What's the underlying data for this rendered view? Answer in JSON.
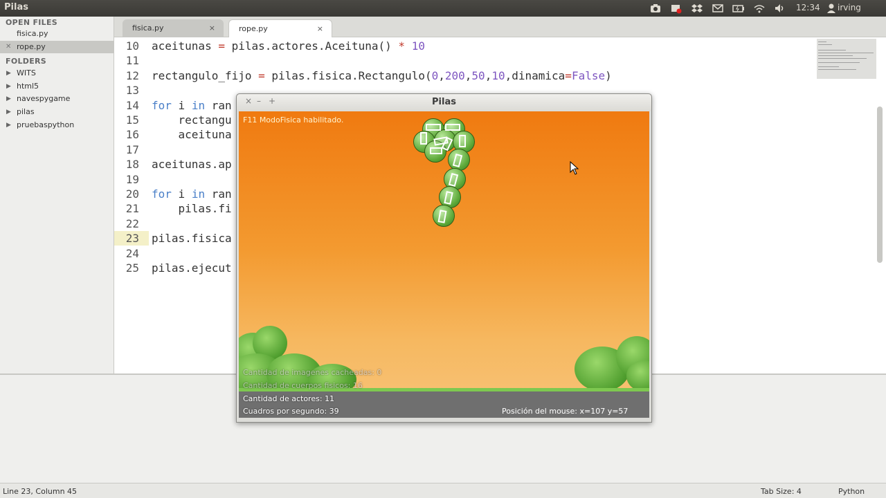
{
  "panel": {
    "app_title": "Pilas",
    "clock": "12:34",
    "user": "irving",
    "icons": [
      "camera-icon",
      "record-icon",
      "dropbox-icon",
      "mail-icon",
      "battery-icon",
      "wifi-icon",
      "volume-icon",
      "user-icon"
    ]
  },
  "sidebar": {
    "open_files_header": "OPEN FILES",
    "open_files": [
      {
        "name": "fisica.py",
        "active": false
      },
      {
        "name": "rope.py",
        "active": true
      }
    ],
    "folders_header": "FOLDERS",
    "folders": [
      "WITS",
      "html5",
      "navespygame",
      "pilas",
      "pruebaspython"
    ]
  },
  "tabs": [
    {
      "label": "fisica.py",
      "close": "×",
      "active": false
    },
    {
      "label": "rope.py",
      "close": "×",
      "active": true
    }
  ],
  "editor": {
    "current_line": 23,
    "lines": [
      {
        "n": "10",
        "text": "aceitunas = pilas.actores.Aceituna() * 10"
      },
      {
        "n": "11",
        "text": ""
      },
      {
        "n": "12",
        "text": "rectangulo_fijo = pilas.fisica.Rectangulo(0,200,50,10,dinamica=False)"
      },
      {
        "n": "13",
        "text": ""
      },
      {
        "n": "14",
        "text": "for i in ran"
      },
      {
        "n": "15",
        "text": "    rectangu"
      },
      {
        "n": "16",
        "text": "    aceituna"
      },
      {
        "n": "17",
        "text": ""
      },
      {
        "n": "18",
        "text": "aceitunas.ap"
      },
      {
        "n": "19",
        "text": ""
      },
      {
        "n": "20",
        "text": "for i in ran"
      },
      {
        "n": "21",
        "text": "    pilas.fi"
      },
      {
        "n": "22",
        "text": ""
      },
      {
        "n": "23",
        "text": "pilas.fisica"
      },
      {
        "n": "24",
        "text": ""
      },
      {
        "n": "25",
        "text": "pilas.ejecut"
      }
    ]
  },
  "status": {
    "position": "Line 23, Column 45",
    "tab_size": "Tab Size: 4",
    "language": "Python"
  },
  "pilas_window": {
    "title": "Pilas",
    "buttons": [
      "×",
      "–",
      "+"
    ],
    "physics_msg": "F11 ModoFisica habilitado.",
    "hud": {
      "cached_images": "Cantidad de imagenes cacheadas: 0",
      "physics_bodies": "Cantidad de cuerpos fisicos: 16",
      "actors": "Cantidad de actores: 11",
      "fps": "Cuadros por segundo: 39",
      "mouse": "Posición del mouse: x=107 y=57"
    }
  },
  "colors": {
    "keyword": "#4a7fc8",
    "number": "#7e56c0",
    "operator": "#c0392b",
    "sky_top": "#f07a10",
    "sky_bottom": "#f8c47a"
  }
}
